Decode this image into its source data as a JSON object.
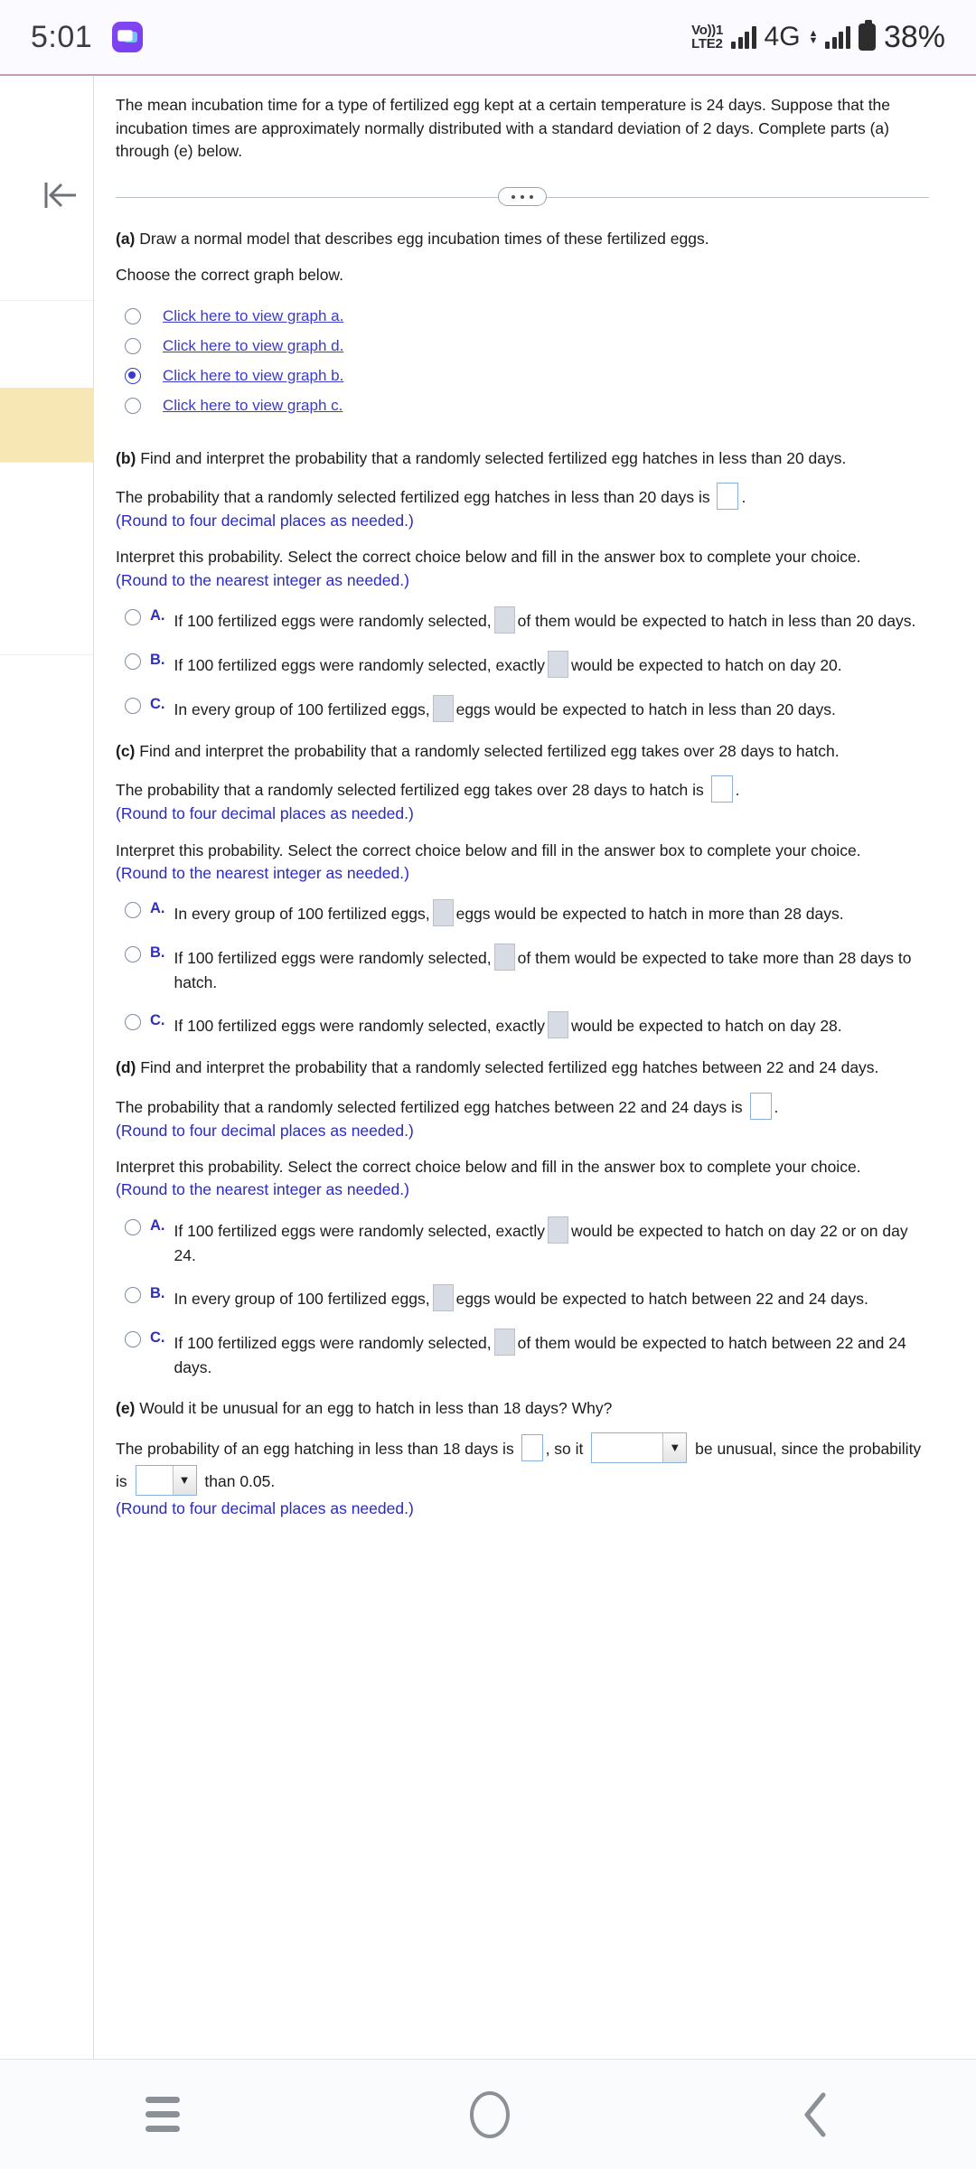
{
  "status_bar": {
    "time": "5:01",
    "app_icon": "messages-icon",
    "volte_line1": "Vo))1",
    "volte_line2": "LTE2",
    "network": "4G",
    "battery_percent": "38%"
  },
  "left_rail": {
    "back_icon": "collapse-left-icon"
  },
  "problem": {
    "statement": "The mean incubation time for a type of fertilized egg kept at a certain temperature is 24 days. Suppose that the incubation times are approximately normally distributed with a standard deviation of 2 days. Complete parts (a) through (e) below."
  },
  "part_a": {
    "label": "(a)",
    "question": "Draw a normal model that describes egg incubation times of these fertilized eggs.",
    "instruction": "Choose the correct graph below.",
    "options": [
      {
        "label": "Click here to view graph a.",
        "selected": false
      },
      {
        "label": "Click here to view graph d.",
        "selected": false
      },
      {
        "label": "Click here to view graph b.",
        "selected": true
      },
      {
        "label": "Click here to view graph c.",
        "selected": false
      }
    ]
  },
  "part_b": {
    "label": "(b)",
    "question": "Find and interpret the probability that a randomly selected fertilized egg hatches in less than 20 days.",
    "answer_prefix": "The probability that a randomly selected fertilized egg hatches in less than 20 days is",
    "answer_suffix": ".",
    "answer_value": "",
    "round_note": "(Round to four decimal places as needed.)",
    "interpret_text": "Interpret this probability. Select the correct choice below and fill in the answer box to complete your choice.",
    "interpret_note": "(Round to the nearest integer as needed.)",
    "choices": [
      {
        "letter": "A.",
        "pre": "If 100 fertilized eggs were randomly selected,",
        "post": "of them would be expected to hatch in less than 20 days.",
        "value": ""
      },
      {
        "letter": "B.",
        "pre": "If 100 fertilized eggs were randomly selected, exactly",
        "post": "would be expected to hatch on day 20.",
        "value": ""
      },
      {
        "letter": "C.",
        "pre": "In every group of 100 fertilized eggs,",
        "post": "eggs would be expected to hatch in less than 20 days.",
        "value": ""
      }
    ]
  },
  "part_c": {
    "label": "(c)",
    "question": "Find and interpret the probability that a randomly selected fertilized egg takes over 28 days to hatch.",
    "answer_prefix": "The probability that a randomly selected fertilized egg takes over 28 days to hatch is",
    "answer_suffix": ".",
    "answer_value": "",
    "round_note": "(Round to four decimal places as needed.)",
    "interpret_text": "Interpret this probability. Select the correct choice below and fill in the answer box to complete your choice.",
    "interpret_note": "(Round to the nearest integer as needed.)",
    "choices": [
      {
        "letter": "A.",
        "pre": "In every group of 100 fertilized eggs,",
        "post": "eggs would be expected to hatch in more than 28 days.",
        "value": ""
      },
      {
        "letter": "B.",
        "pre": "If 100 fertilized eggs were randomly selected,",
        "post": "of them would be expected to take more than 28 days to hatch.",
        "value": ""
      },
      {
        "letter": "C.",
        "pre": "If 100 fertilized eggs were randomly selected, exactly",
        "post": "would be expected to hatch on day 28.",
        "value": ""
      }
    ]
  },
  "part_d": {
    "label": "(d)",
    "question": "Find and interpret the probability that a randomly selected fertilized egg hatches between 22 and 24 days.",
    "answer_prefix": "The probability that a randomly selected fertilized egg hatches between 22 and 24 days is",
    "answer_suffix": ".",
    "answer_value": "",
    "round_note": "(Round to four decimal places as needed.)",
    "interpret_text": "Interpret this probability. Select the correct choice below and fill in the answer box to complete your choice.",
    "interpret_note": "(Round to the nearest integer as needed.)",
    "choices": [
      {
        "letter": "A.",
        "pre": "If 100 fertilized eggs were randomly selected, exactly",
        "post": "would be expected to hatch on day 22 or on day 24.",
        "value": ""
      },
      {
        "letter": "B.",
        "pre": "In every group of 100 fertilized eggs,",
        "post": "eggs would be expected to hatch between 22 and 24 days.",
        "value": ""
      },
      {
        "letter": "C.",
        "pre": "If 100 fertilized eggs were randomly selected,",
        "post": "of them would be expected to hatch between 22 and 24 days.",
        "value": ""
      }
    ]
  },
  "part_e": {
    "label": "(e)",
    "question": "Would it be unusual for an egg to hatch in less than 18 days? Why?",
    "seg1": "The probability of an egg hatching in less than 18 days is",
    "seg2": ", so it",
    "seg3": "be unusual, since the probability is",
    "seg4": "than 0.05.",
    "prob_value": "",
    "unusual_select_value": "",
    "compare_select_value": "",
    "round_note": "(Round to four decimal places as needed.)"
  },
  "nav_bar": {
    "recents": "recents-icon",
    "home": "home-icon",
    "back": "back-icon"
  }
}
